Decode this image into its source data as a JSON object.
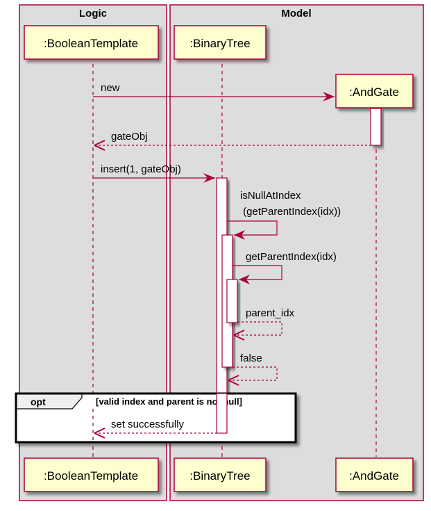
{
  "diagram": {
    "type": "sequence",
    "colors": {
      "line": "#A80036",
      "box_bg": "#DDDDDD",
      "participant_bg": "#FEFECE",
      "activation_bg": "#FFFFFF",
      "shadow": "#999999",
      "opt_border": "#000000",
      "opt_tab_bg": "#EEEEEE"
    },
    "boxes": [
      {
        "id": "logic",
        "title": "Logic"
      },
      {
        "id": "model",
        "title": "Model"
      }
    ],
    "participants": [
      {
        "id": "booleantemplate",
        "label": ":BooleanTemplate",
        "box": "logic"
      },
      {
        "id": "binarytree",
        "label": ":BinaryTree",
        "box": "model"
      },
      {
        "id": "andgate",
        "label": ":AndGate",
        "box": "model",
        "created": true
      }
    ],
    "messages": [
      {
        "id": "new",
        "from": "booleantemplate",
        "to": "andgate",
        "label": "new",
        "kind": "create"
      },
      {
        "id": "gateobj-return",
        "from": "andgate",
        "to": "booleantemplate",
        "label": "gateObj",
        "kind": "return"
      },
      {
        "id": "insert",
        "from": "booleantemplate",
        "to": "binarytree",
        "label": "insert(1, gateObj)",
        "kind": "sync"
      },
      {
        "id": "isnullatindex",
        "from": "binarytree",
        "to": "binarytree",
        "label_lines": [
          "isNullAtIndex",
          " (getParentIndex(idx))"
        ],
        "kind": "self"
      },
      {
        "id": "getparentindex",
        "from": "binarytree",
        "to": "binarytree",
        "label": "getParentIndex(idx)",
        "kind": "self"
      },
      {
        "id": "parent-idx-return",
        "from": "binarytree",
        "to": "binarytree",
        "label": "parent_idx",
        "kind": "self-return"
      },
      {
        "id": "false-return",
        "from": "binarytree",
        "to": "binarytree",
        "label": "false",
        "kind": "self-return"
      },
      {
        "id": "set-successfully",
        "from": "binarytree",
        "to": "booleantemplate",
        "label": "set successfully",
        "kind": "return"
      }
    ],
    "fragments": [
      {
        "id": "opt",
        "operator": "opt",
        "guard": "[valid index and parent is not null]"
      }
    ]
  }
}
